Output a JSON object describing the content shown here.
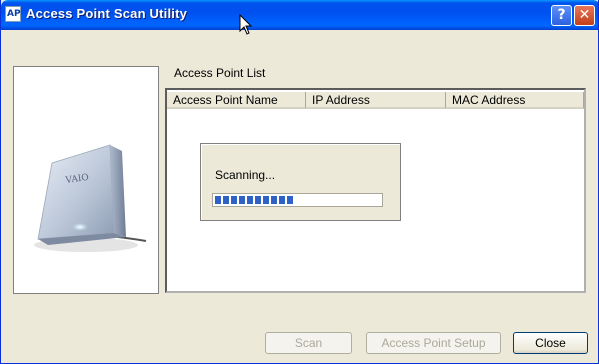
{
  "window": {
    "title": "Access Point Scan Utility",
    "icon_text": "AP"
  },
  "titlebar_buttons": {
    "help": "?",
    "close": "✕"
  },
  "list": {
    "label": "Access Point List",
    "columns": [
      "Access Point Name",
      "IP Address",
      "MAC Address"
    ]
  },
  "scan_dialog": {
    "message": "Scanning...",
    "progress": 0.52
  },
  "buttons": {
    "scan": "Scan",
    "setup": "Access Point Setup",
    "close": "Close"
  },
  "colors": {
    "progress_fill": "#2f62c8",
    "titlebar": "#0053ee"
  }
}
